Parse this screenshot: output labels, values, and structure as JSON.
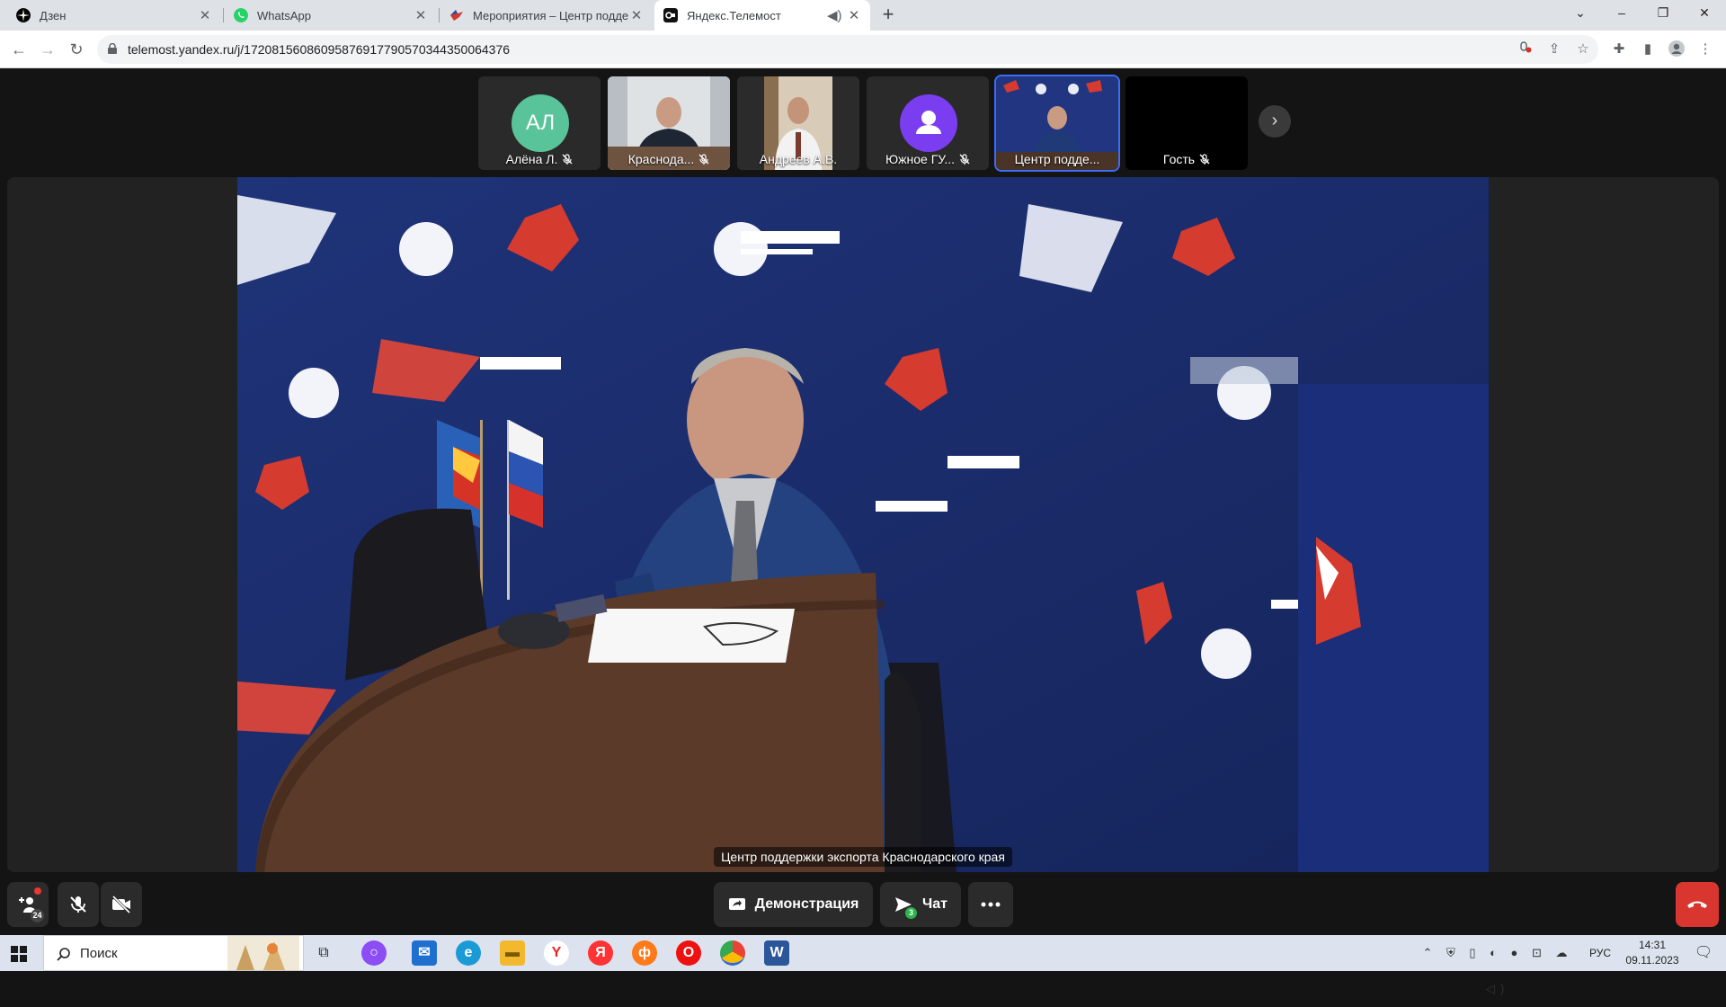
{
  "browser": {
    "tabs": [
      {
        "title": "Дзен",
        "active": false
      },
      {
        "title": "WhatsApp",
        "active": false
      },
      {
        "title": "Мероприятия – Центр поддерж",
        "active": false
      },
      {
        "title": "Яндекс.Телемост",
        "active": true
      }
    ],
    "new_tab": "+",
    "window_controls": {
      "collapse": "⌄",
      "minimize": "–",
      "restore": "❐",
      "close": "✕"
    },
    "url": "telemost.yandex.ru/j/17208156086095876917790570344350064376"
  },
  "participants": [
    {
      "label": "Алёна Л.",
      "initials": "АЛ",
      "avatar_color": "#59c49a",
      "muted": true,
      "kind": "avatar"
    },
    {
      "label": "Краснода...",
      "muted": true,
      "kind": "video"
    },
    {
      "label": "Андреев А.В.",
      "muted": false,
      "kind": "video"
    },
    {
      "label": "Южное ГУ...",
      "muted": true,
      "kind": "avatar-icon",
      "avatar_color": "#7b3df0"
    },
    {
      "label": "Центр подде...",
      "muted": false,
      "kind": "video"
    },
    {
      "label": "Гость",
      "muted": true,
      "kind": "black"
    }
  ],
  "main_video": {
    "caption": "Центр поддержки экспорта Краснодарского края",
    "backdrop_color": "#1d2e6e"
  },
  "controls": {
    "participants_count": "24",
    "demo_label": "Демонстрация",
    "chat_label": "Чат",
    "chat_badge": "3",
    "hangup_color": "#d9362f"
  },
  "taskbar": {
    "search_placeholder": "Поиск",
    "language": "РУС",
    "time": "14:31",
    "date": "09.11.2023"
  }
}
